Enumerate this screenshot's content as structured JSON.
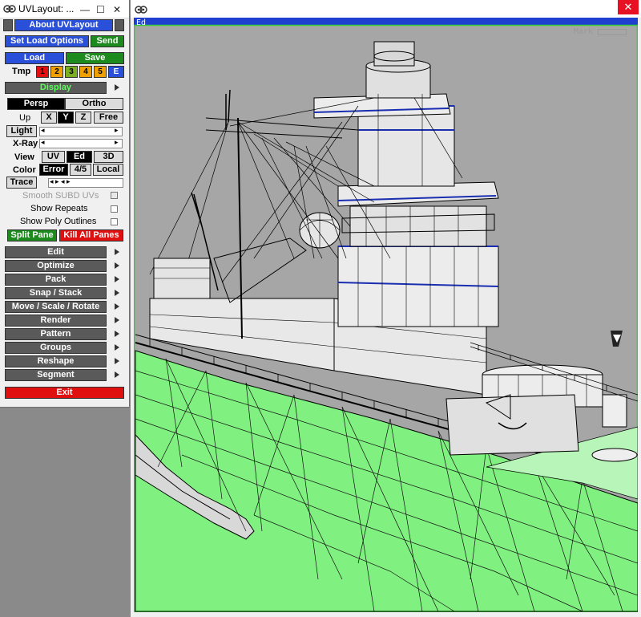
{
  "left_window": {
    "title": "UVLayout: ...",
    "about_label": "About UVLayout",
    "set_load_options_label": "Set Load Options",
    "send_label": "Send",
    "load_label": "Load",
    "save_label": "Save",
    "tmp_label": "Tmp",
    "tmp_slots": [
      "1",
      "2",
      "3",
      "4",
      "5",
      "E"
    ],
    "display_label": "Display",
    "persp_label": "Persp",
    "ortho_label": "Ortho",
    "up_label": "Up",
    "up_options": [
      "X",
      "Y",
      "Z",
      "Free"
    ],
    "up_selected": "Y",
    "light_label": "Light",
    "xray_label": "X-Ray",
    "view_label": "View",
    "view_options": [
      "UV",
      "Ed",
      "3D"
    ],
    "view_selected": "Ed",
    "color_label": "Color",
    "color_options": [
      "Error",
      "4/5",
      "Local"
    ],
    "color_selected": "Error",
    "trace_label": "Trace",
    "smooth_subd_label": "Smooth SUBD UVs",
    "show_repeats_label": "Show Repeats",
    "show_poly_outlines_label": "Show Poly Outlines",
    "split_pane_label": "Split Pane",
    "kill_all_panes_label": "Kill All Panes",
    "menu_items": [
      "Edit",
      "Optimize",
      "Pack",
      "Snap / Stack",
      "Move / Scale / Rotate",
      "Render",
      "Pattern",
      "Groups",
      "Reshape",
      "Segment"
    ],
    "exit_label": "Exit"
  },
  "viewport": {
    "pane_label": "Ed",
    "mark_label": "Mark"
  },
  "colors": {
    "accent_blue": "#2a4fd8",
    "green": "#1c8a1c",
    "red": "#e01010",
    "viewport_bg": "#a6a6a6",
    "hull_green": "#80f080",
    "viewport_border": "#33cc33"
  }
}
